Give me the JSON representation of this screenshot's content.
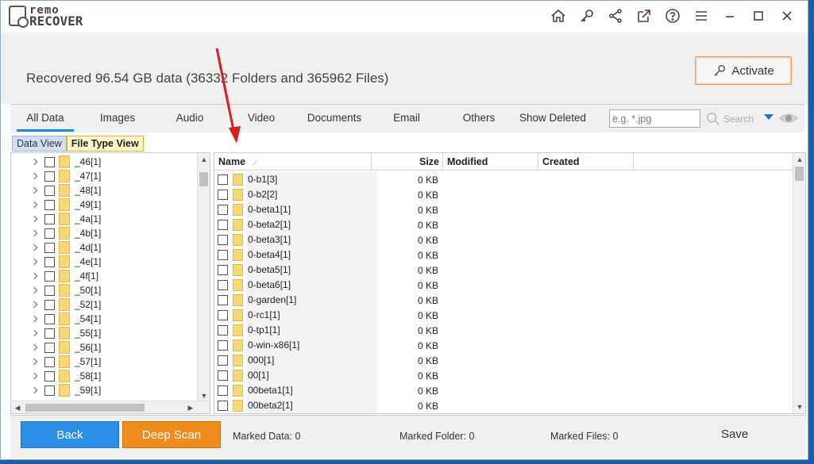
{
  "app": {
    "logo_top": "remo",
    "logo_bottom": "RECOVER"
  },
  "toolbar": {
    "icons": [
      "home-icon",
      "key-icon",
      "share-icon",
      "export-icon",
      "help-icon",
      "menu-icon",
      "minimize-icon",
      "maximize-icon",
      "close-icon"
    ]
  },
  "header": {
    "recovered_text": "Recovered 96.54 GB data (36332 Folders and 365962 Files)",
    "activate_label": "Activate"
  },
  "tabs": [
    {
      "label": "All Data",
      "active": true
    },
    {
      "label": "Images"
    },
    {
      "label": "Audio"
    },
    {
      "label": "Video"
    },
    {
      "label": "Documents"
    },
    {
      "label": "Email"
    },
    {
      "label": "Others"
    },
    {
      "label": "Show Deleted"
    }
  ],
  "filter": {
    "placeholder": "e.g. *.jpg",
    "search_label": "Search"
  },
  "views": {
    "data_view": "Data View",
    "file_type_view": "File Type View"
  },
  "tree": {
    "items": [
      "_46[1]",
      "_47[1]",
      "_48[1]",
      "_49[1]",
      "_4a[1]",
      "_4b[1]",
      "_4d[1]",
      "_4e[1]",
      "_4f[1]",
      "_50[1]",
      "_52[1]",
      "_54[1]",
      "_55[1]",
      "_56[1]",
      "_57[1]",
      "_58[1]",
      "_59[1]"
    ]
  },
  "list": {
    "columns": {
      "name": "Name",
      "size": "Size",
      "modified": "Modified",
      "created": "Created"
    },
    "rows": [
      {
        "name": "0-b1[3]",
        "size": "0 KB"
      },
      {
        "name": "0-b2[2]",
        "size": "0 KB"
      },
      {
        "name": "0-beta1[1]",
        "size": "0 KB"
      },
      {
        "name": "0-beta2[1]",
        "size": "0 KB"
      },
      {
        "name": "0-beta3[1]",
        "size": "0 KB"
      },
      {
        "name": "0-beta4[1]",
        "size": "0 KB"
      },
      {
        "name": "0-beta5[1]",
        "size": "0 KB"
      },
      {
        "name": "0-beta6[1]",
        "size": "0 KB"
      },
      {
        "name": "0-garden[1]",
        "size": "0 KB"
      },
      {
        "name": "0-rc1[1]",
        "size": "0 KB"
      },
      {
        "name": "0-tp1[1]",
        "size": "0 KB"
      },
      {
        "name": "0-win-x86[1]",
        "size": "0 KB"
      },
      {
        "name": "000[1]",
        "size": "0 KB"
      },
      {
        "name": "00[1]",
        "size": "0 KB"
      },
      {
        "name": "00beta1[1]",
        "size": "0 KB"
      },
      {
        "name": "00beta2[1]",
        "size": "0 KB"
      }
    ]
  },
  "footer": {
    "back_label": "Back",
    "deep_scan_label": "Deep Scan",
    "marked_data": "Marked Data: 0",
    "marked_folder": "Marked Folder:  0",
    "marked_files": "Marked Files: 0",
    "save_label": "Save"
  },
  "colors": {
    "accent_blue": "#2b8fe6",
    "accent_orange": "#f08c1e",
    "folder_yellow": "#f8d775",
    "annotation_red": "#d42020"
  }
}
